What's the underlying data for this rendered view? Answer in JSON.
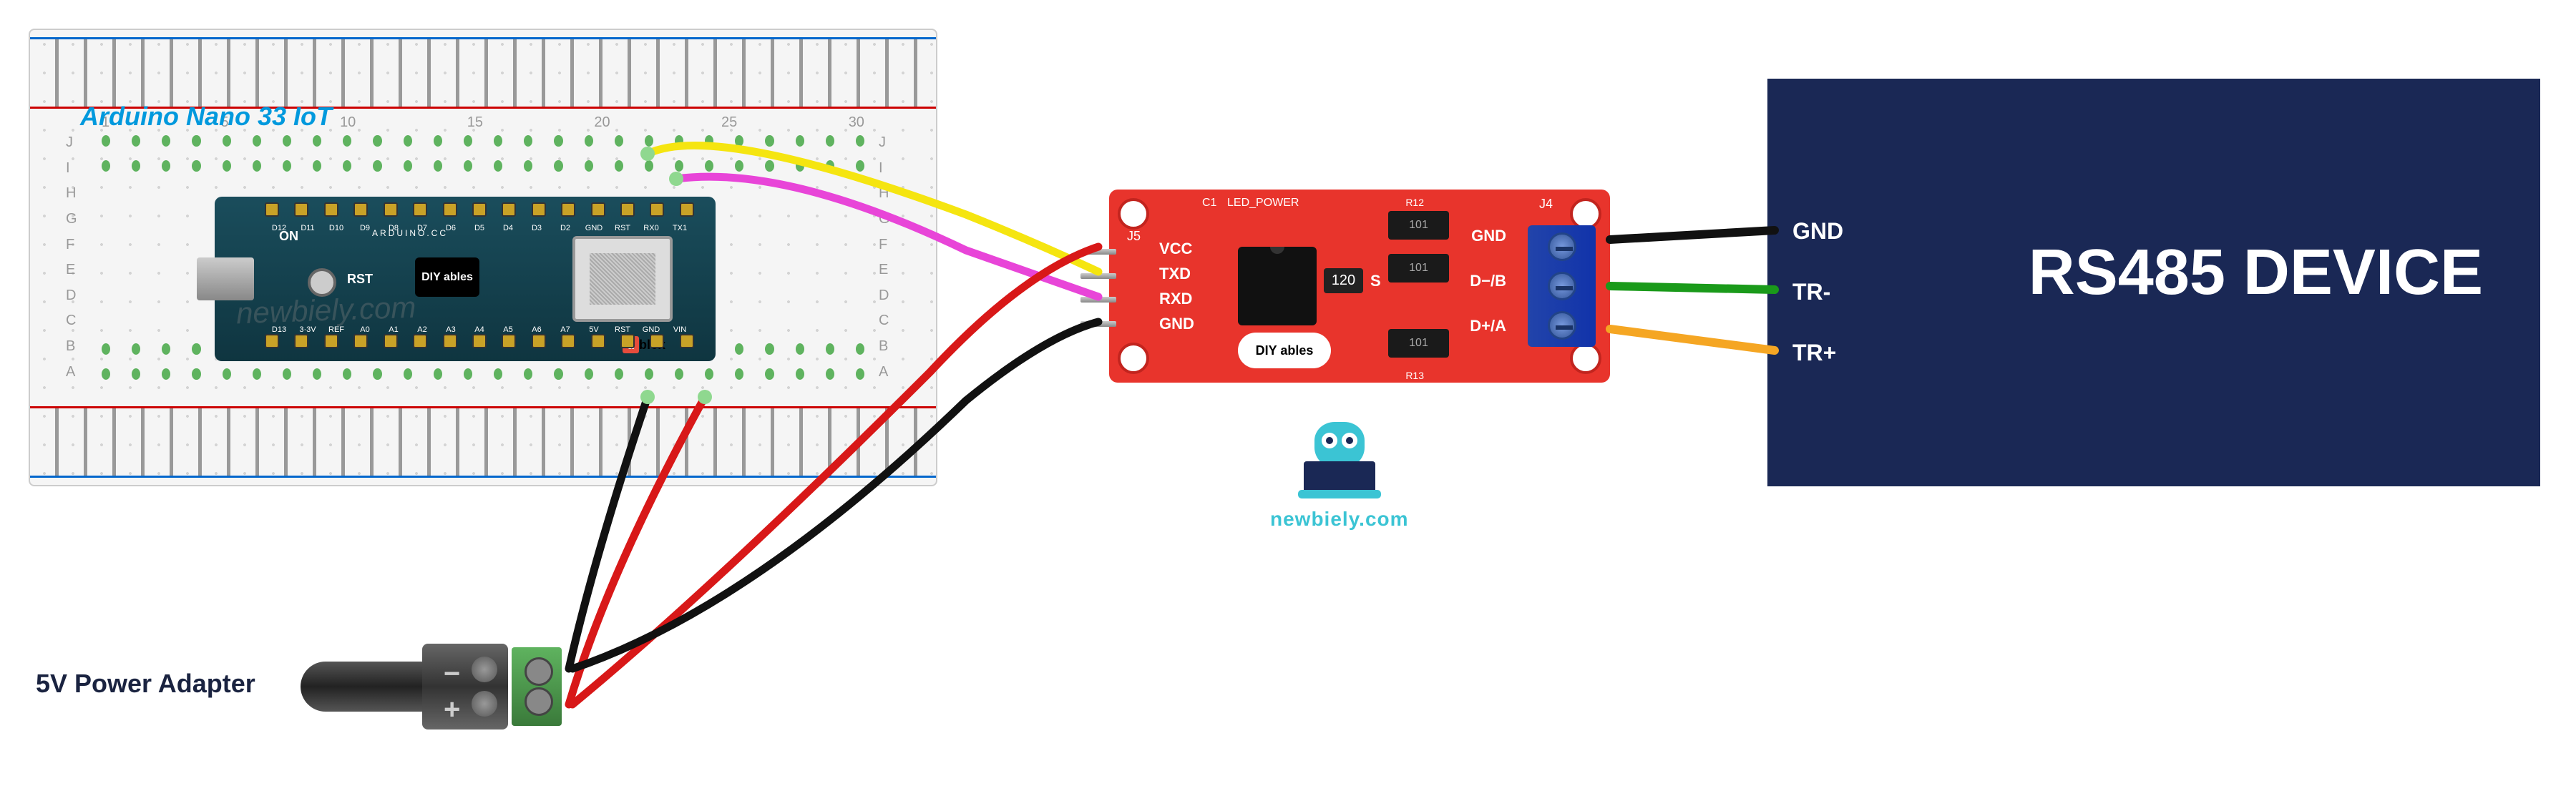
{
  "labels": {
    "arduino_board": "Arduino Nano 33 IoT",
    "power_adapter": "5V Power Adapter",
    "rs485_device_title": "RS485 DEVICE"
  },
  "breadboard": {
    "column_numbers": [
      "1",
      "5",
      "10",
      "15",
      "20",
      "25",
      "30"
    ],
    "row_letters_top": [
      "J",
      "I",
      "H",
      "G",
      "F"
    ],
    "row_letters_bot": [
      "E",
      "D",
      "C",
      "B",
      "A"
    ]
  },
  "nano": {
    "on_label": "ON",
    "rst_label": "RST",
    "arduino_cc": "ARDUINO.CC",
    "logo_text": "DIY ables",
    "ublox_u": "u",
    "ublox_blox": "blox",
    "pins_top": [
      "D12",
      "D11",
      "D10",
      "D9",
      "D8",
      "D7",
      "D6",
      "D5",
      "D4",
      "D3",
      "D2",
      "GND",
      "RST",
      "RX0",
      "TX1"
    ],
    "pins_bot": [
      "D13",
      "3·3V",
      "REF",
      "A0",
      "A1",
      "A2",
      "A3",
      "A4",
      "A5",
      "A6",
      "A7",
      "5V",
      "RST",
      "GND",
      "VIN"
    ]
  },
  "barrel_jack": {
    "neg": "−",
    "pos": "+"
  },
  "rs485_module": {
    "left_pins": {
      "vcc": "VCC",
      "txd": "TXD",
      "rxd": "RXD",
      "gnd": "GND"
    },
    "right_terminals": {
      "gnd": "GND",
      "dmb": "D−/B",
      "dpa": "D+/A"
    },
    "silkscreen": {
      "j5": "J5",
      "j4": "J4",
      "c1": "C1",
      "led_power": "LED_POWER",
      "r12": "R12",
      "r13": "R13"
    },
    "r120": "120",
    "s_label": "S",
    "smd_101": "101",
    "logo": "DIY ables"
  },
  "rs485_device": {
    "pins": {
      "gnd": "GND",
      "trm": "TR-",
      "trp": "TR+"
    }
  },
  "owl": {
    "site": "newbiely.com"
  },
  "watermark": "newbiely.com",
  "wiring": {
    "description": "Arduino Nano 33 IoT on breadboard connected to DIYables RS485-to-TTL module and external RS485 device, powered by 5V barrel-jack adapter",
    "connections": [
      {
        "from": "Nano TX1",
        "to": "RS485 module RXD",
        "color": "magenta"
      },
      {
        "from": "Nano RX0",
        "to": "RS485 module TXD",
        "color": "yellow"
      },
      {
        "from": "5V adapter +",
        "to": "Nano VIN",
        "color": "red"
      },
      {
        "from": "5V adapter +",
        "to": "RS485 module VCC",
        "color": "red"
      },
      {
        "from": "5V adapter −",
        "to": "Nano GND",
        "color": "black"
      },
      {
        "from": "5V adapter −",
        "to": "RS485 module GND",
        "color": "black"
      },
      {
        "from": "RS485 module GND (terminal)",
        "to": "RS485 device GND",
        "color": "black"
      },
      {
        "from": "RS485 module D−/B",
        "to": "RS485 device TR-",
        "color": "green"
      },
      {
        "from": "RS485 module D+/A",
        "to": "RS485 device TR+",
        "color": "orange"
      }
    ]
  }
}
